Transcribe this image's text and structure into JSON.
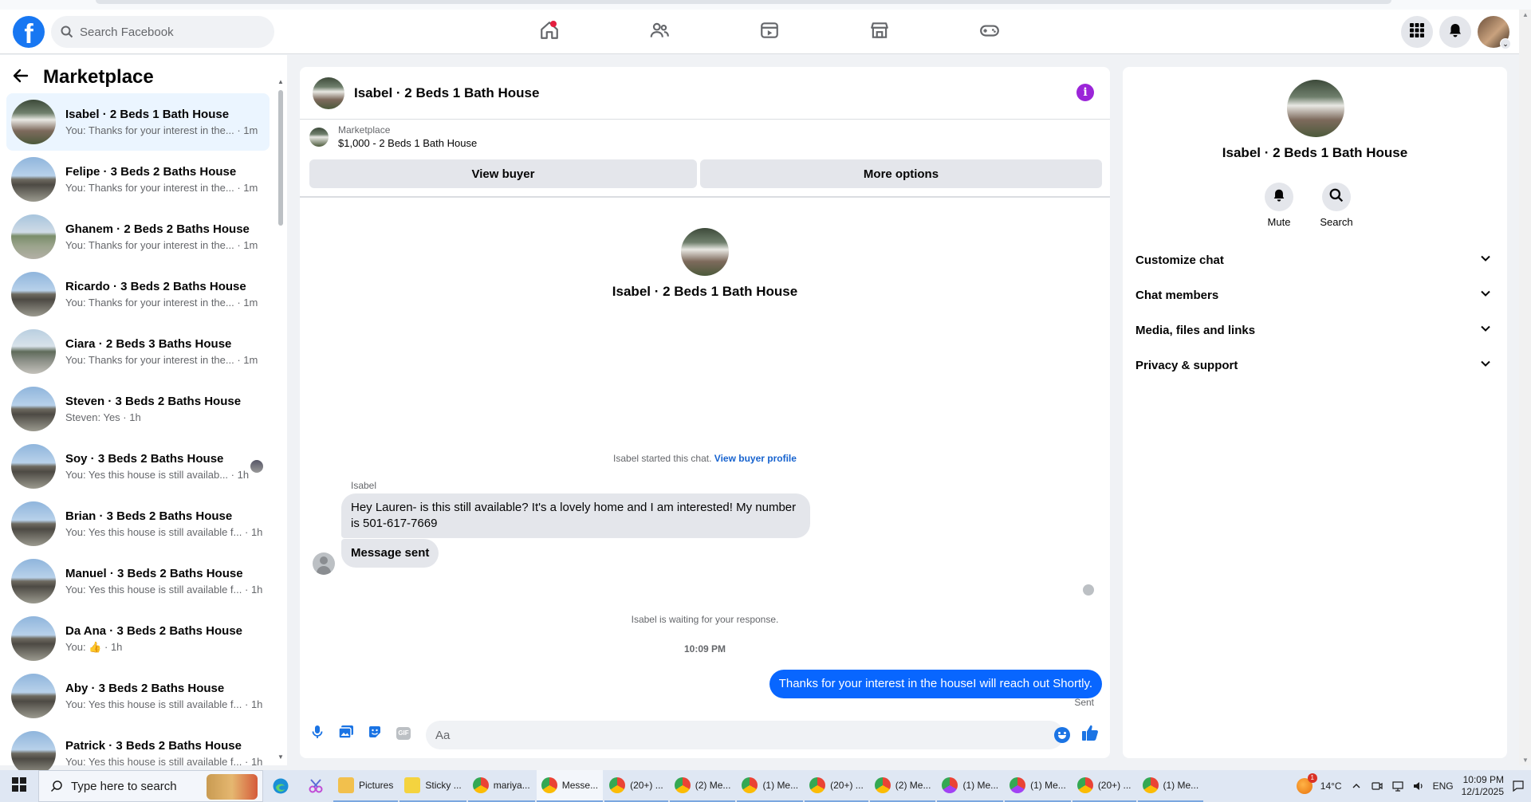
{
  "topnav": {
    "search_placeholder": "Search Facebook",
    "logo": "facebook-logo",
    "nav_icons": [
      "home-icon",
      "friends-icon",
      "video-icon",
      "marketplace-icon",
      "gaming-icon"
    ],
    "right_icons": [
      "menu-grid-icon",
      "notifications-bell-icon",
      "account-avatar"
    ]
  },
  "sidebar": {
    "title": "Marketplace",
    "conversations": [
      {
        "name": "Isabel · 2 Beds 1 Bath House",
        "preview": "You: Thanks for your interest in the...",
        "time": "1m",
        "active": true
      },
      {
        "name": "Felipe · 3 Beds 2 Baths House",
        "preview": "You: Thanks for your interest in the...",
        "time": "1m"
      },
      {
        "name": "Ghanem · 2 Beds 2 Baths House",
        "preview": "You: Thanks for your interest in the...",
        "time": "1m"
      },
      {
        "name": "Ricardo · 3 Beds 2 Baths House",
        "preview": "You: Thanks for your interest in the...",
        "time": "1m"
      },
      {
        "name": "Ciara · 2 Beds 3 Baths House",
        "preview": "You: Thanks for your interest in the...",
        "time": "1m"
      },
      {
        "name": "Steven · 3 Beds 2 Baths House",
        "preview": "Steven: Yes",
        "time": "1h"
      },
      {
        "name": "Soy · 3 Beds 2 Baths House",
        "preview": "You: Yes this house is still availab...",
        "time": "1h"
      },
      {
        "name": "Brian · 3 Beds 2 Baths House",
        "preview": "You: Yes this house is still available f...",
        "time": "1h"
      },
      {
        "name": "Manuel · 3 Beds 2 Baths House",
        "preview": "You: Yes this house is still available f...",
        "time": "1h"
      },
      {
        "name": "Da Ana · 3 Beds 2 Baths House",
        "preview": "You:",
        "time": "1h"
      },
      {
        "name": "Aby · 3 Beds 2 Baths House",
        "preview": "You: Yes this house is still available f...",
        "time": "1h"
      },
      {
        "name": "Patrick · 3 Beds 2 Baths House",
        "preview": "You: Yes this house is still available f...",
        "time": "1h"
      }
    ]
  },
  "chat": {
    "title": "Isabel · 2 Beds 1 Bath House",
    "listing_label": "Marketplace",
    "listing_price": "$1,000 - 2 Beds 1 Bath House",
    "view_buyer": "View buyer",
    "more_options": "More options",
    "profile_name": "Isabel · 2 Beds 1 Bath House",
    "started_text": "Isabel started this chat.",
    "view_buyer_profile": "View buyer profile",
    "sender_name": "Isabel",
    "incoming_message": "Hey Lauren- is this still available? It's a lovely home and I am interested! My number is 501-617-7669",
    "message_sent": "Message sent",
    "waiting_text": "Isabel is waiting for your response.",
    "timestamp": "10:09 PM",
    "outgoing_message": "Thanks for your interest in the houseI will reach out Shortly.",
    "sent_status": "Sent",
    "input_placeholder": "Aa"
  },
  "right_panel": {
    "name": "Isabel · 2 Beds 1 Bath House",
    "mute_label": "Mute",
    "search_label": "Search",
    "sections": [
      "Customize chat",
      "Chat members",
      "Media, files and links",
      "Privacy & support"
    ]
  },
  "taskbar": {
    "search_placeholder": "Type here to search",
    "apps": [
      {
        "label": "Pictures",
        "color": "#2b6cb0"
      },
      {
        "label": "Sticky ...",
        "color": "#2a2a2a"
      },
      {
        "label": "mariya...",
        "color": "#34a853"
      },
      {
        "label": "Messe...",
        "color": "#34a853",
        "active": true
      },
      {
        "label": "(20+) ...",
        "color": "#34a853"
      },
      {
        "label": "(2) Me...",
        "color": "#34a853"
      },
      {
        "label": "(1) Me...",
        "color": "#34a853"
      },
      {
        "label": "(20+) ...",
        "color": "#34a853"
      },
      {
        "label": "(2) Me...",
        "color": "#34a853"
      },
      {
        "label": "(1) Me...",
        "color": "#a142f4"
      },
      {
        "label": "(1) Me...",
        "color": "#a142f4"
      },
      {
        "label": "(20+) ...",
        "color": "#34a853"
      },
      {
        "label": "(1) Me...",
        "color": "#34a853"
      }
    ],
    "weather_badge": "1",
    "temperature": "14°C",
    "language": "ENG",
    "time": "10:09 PM",
    "date": "12/1/2025"
  }
}
